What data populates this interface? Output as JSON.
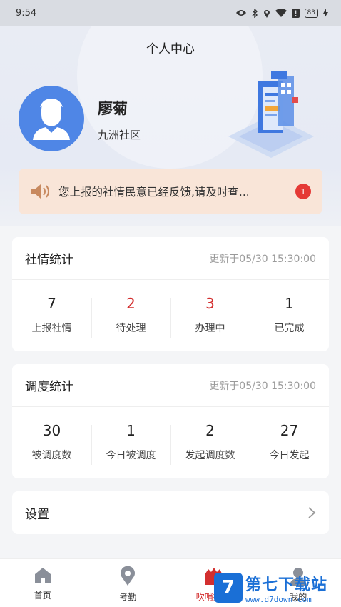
{
  "status_bar": {
    "time": "9:54",
    "battery": "83"
  },
  "header": {
    "title": "个人中心"
  },
  "profile": {
    "name": "廖菊",
    "community": "九洲社区"
  },
  "notice": {
    "text": "您上报的社情民意已经反馈,请及时查...",
    "badge_count": "1"
  },
  "social_stats": {
    "title": "社情统计",
    "updated": "更新于05/30 15:30:00",
    "items": [
      {
        "value": "7",
        "label": "上报社情",
        "color": "#222222"
      },
      {
        "value": "2",
        "label": "待处理",
        "color": "#d32f2f"
      },
      {
        "value": "3",
        "label": "办理中",
        "color": "#d32f2f"
      },
      {
        "value": "1",
        "label": "已完成",
        "color": "#222222"
      }
    ]
  },
  "dispatch_stats": {
    "title": "调度统计",
    "updated": "更新于05/30 15:30:00",
    "items": [
      {
        "value": "30",
        "label": "被调度数"
      },
      {
        "value": "1",
        "label": "今日被调度"
      },
      {
        "value": "2",
        "label": "发起调度数"
      },
      {
        "value": "27",
        "label": "今日发起"
      }
    ]
  },
  "settings": {
    "label": "设置"
  },
  "tabs": [
    {
      "label": "首页",
      "icon": "home-icon"
    },
    {
      "label": "考勤",
      "icon": "location-pin-icon"
    },
    {
      "label": "吹哨报到",
      "icon": "whistle-icon",
      "active": true
    },
    {
      "label": "我的",
      "icon": "user-icon"
    }
  ],
  "watermark": {
    "logo": "7",
    "title": "第七下载站",
    "url": "www.d7down.com"
  },
  "colors": {
    "accent_red": "#d32f2f",
    "avatar_blue": "#4f86e6",
    "notice_bg": "#f9e5d8"
  }
}
